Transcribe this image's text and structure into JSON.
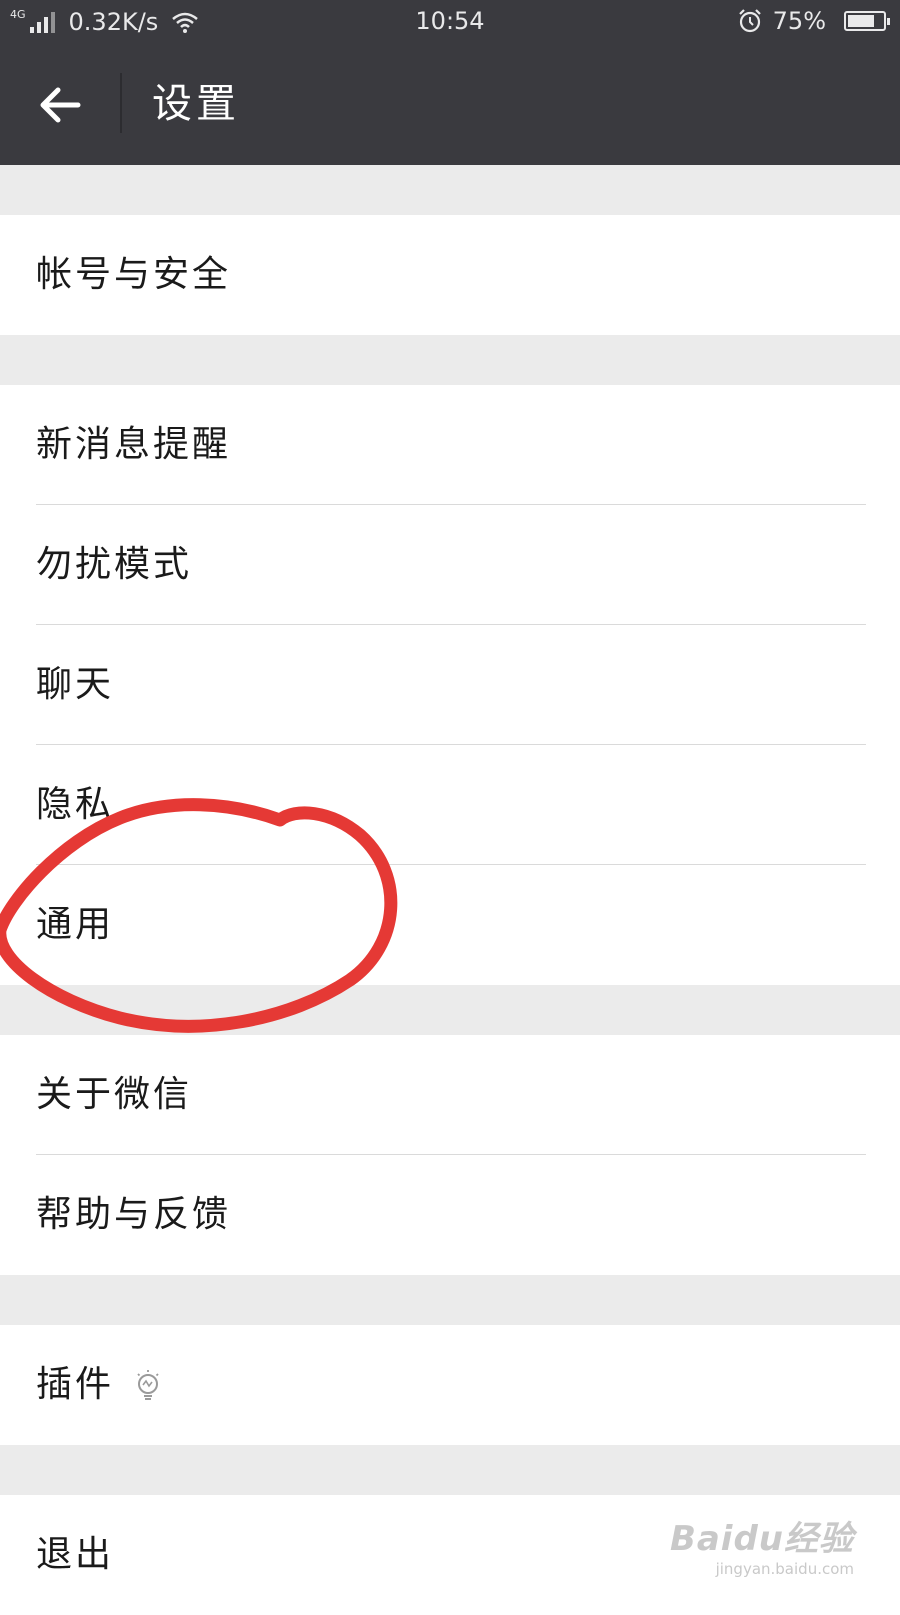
{
  "status_bar": {
    "network_type": "4G",
    "net_speed": "0.32K/s",
    "time": "10:54",
    "battery_text": "75%",
    "battery_level": 0.75
  },
  "header": {
    "title": "设置",
    "back_icon": "arrow-left-icon"
  },
  "settings": {
    "account_security": "帐号与安全",
    "new_message_alerts": "新消息提醒",
    "do_not_disturb": "勿扰模式",
    "chat": "聊天",
    "privacy": "隐私",
    "general": "通用",
    "about_wechat": "关于微信",
    "help_feedback": "帮助与反馈",
    "plugins": "插件",
    "logout": "退出"
  },
  "annotation": {
    "color": "#e53935",
    "highlighted_item": "通用"
  },
  "watermark": {
    "brand": "Baidu经验",
    "site": "jingyan.baidu.com"
  },
  "colors": {
    "bar_background": "#3a3a3f",
    "page_background": "#ebebeb",
    "row_background": "#ffffff"
  }
}
